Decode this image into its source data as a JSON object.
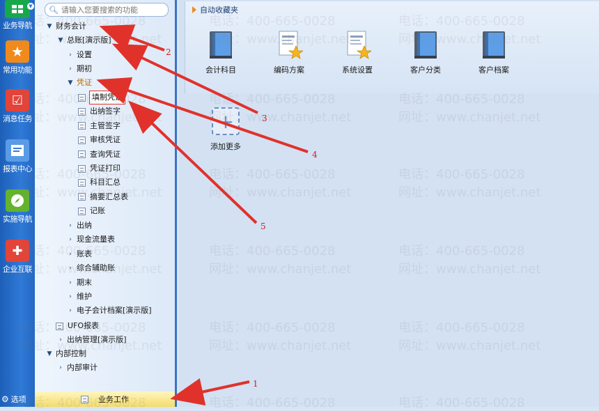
{
  "rail": {
    "items": [
      {
        "label": "业务导航",
        "icon": "grid-icon",
        "color": "#17a84a"
      },
      {
        "label": "常用功能",
        "icon": "star-icon",
        "color": "#f08a1c"
      },
      {
        "label": "消息任务",
        "icon": "task-icon",
        "color": "#e2443a"
      },
      {
        "label": "报表中心",
        "icon": "report-icon",
        "color": "#3a7bd5"
      },
      {
        "label": "实施导航",
        "icon": "compass-icon",
        "color": "#64b32e"
      },
      {
        "label": "企业互联",
        "icon": "connect-icon",
        "color": "#e2443a"
      }
    ],
    "options_label": "选项"
  },
  "search": {
    "placeholder": "请输入您要搜索的功能"
  },
  "tree": {
    "finance": "财务会计",
    "ledger": "总账[演示版]",
    "settings": "设置",
    "opening": "期初",
    "voucher": "凭证",
    "voucher_items": [
      "填制凭证",
      "出纳签字",
      "主管签字",
      "审核凭证",
      "查询凭证",
      "凭证打印",
      "科目汇总",
      "摘要汇总表",
      "记账"
    ],
    "ledger_rest": [
      "出纳",
      "现金流量表",
      "账表",
      "综合辅助账",
      "期末",
      "维护",
      "电子会计档案[演示版]"
    ],
    "ufo": "UFO报表",
    "cashier": "出纳管理[演示版]",
    "internal": "内部控制",
    "audit": "内部审计",
    "bottom_tab": "业务工作"
  },
  "favorites": {
    "title": "自动收藏夹",
    "items": [
      "会计科目",
      "编码方案",
      "系统设置",
      "客户分类",
      "客户档案"
    ],
    "add_more": "添加更多"
  },
  "watermark": {
    "phone": "电话：400-665-0028",
    "site": "网址：www.chanjet.net"
  },
  "annotations": [
    "1",
    "2",
    "3",
    "4",
    "5"
  ],
  "colors": {
    "accent": "#2f7ad6",
    "arrow": "#e0322b",
    "star": "#f7b51d"
  }
}
